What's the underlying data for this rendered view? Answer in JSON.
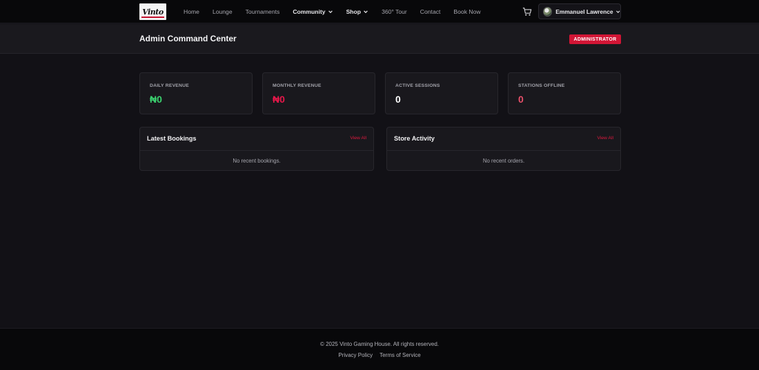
{
  "nav": {
    "logo_text": "Vinto",
    "links": [
      {
        "label": "Home"
      },
      {
        "label": "Lounge"
      },
      {
        "label": "Tournaments"
      },
      {
        "label": "Community"
      },
      {
        "label": "Shop"
      },
      {
        "label": "360° Tour"
      },
      {
        "label": "Contact"
      },
      {
        "label": "Book Now"
      }
    ],
    "user_name": "Emmanuel Lawrence"
  },
  "header": {
    "title": "Admin Command Center",
    "role_badge": "ADMINISTRATOR"
  },
  "stats": [
    {
      "label": "DAILY REVENUE",
      "value": "₦0",
      "color": "#3bd16f"
    },
    {
      "label": "MONTHLY REVENUE",
      "value": "₦0",
      "color": "#e8174a"
    },
    {
      "label": "ACTIVE SESSIONS",
      "value": "0",
      "color": "#ffffff"
    },
    {
      "label": "STATIONS OFFLINE",
      "value": "0",
      "color": "#e8506a"
    }
  ],
  "panels": {
    "bookings": {
      "title": "Latest Bookings",
      "link": "View All",
      "empty": "No recent bookings."
    },
    "store": {
      "title": "Store Activity",
      "link": "View All",
      "empty": "No recent orders."
    }
  },
  "footer": {
    "copyright": "© 2025 Vinto Gaming House. All rights reserved.",
    "privacy": "Privacy Policy",
    "terms": "Terms of Service"
  },
  "colors": {
    "accent": "#d21535",
    "background": "#121116"
  }
}
